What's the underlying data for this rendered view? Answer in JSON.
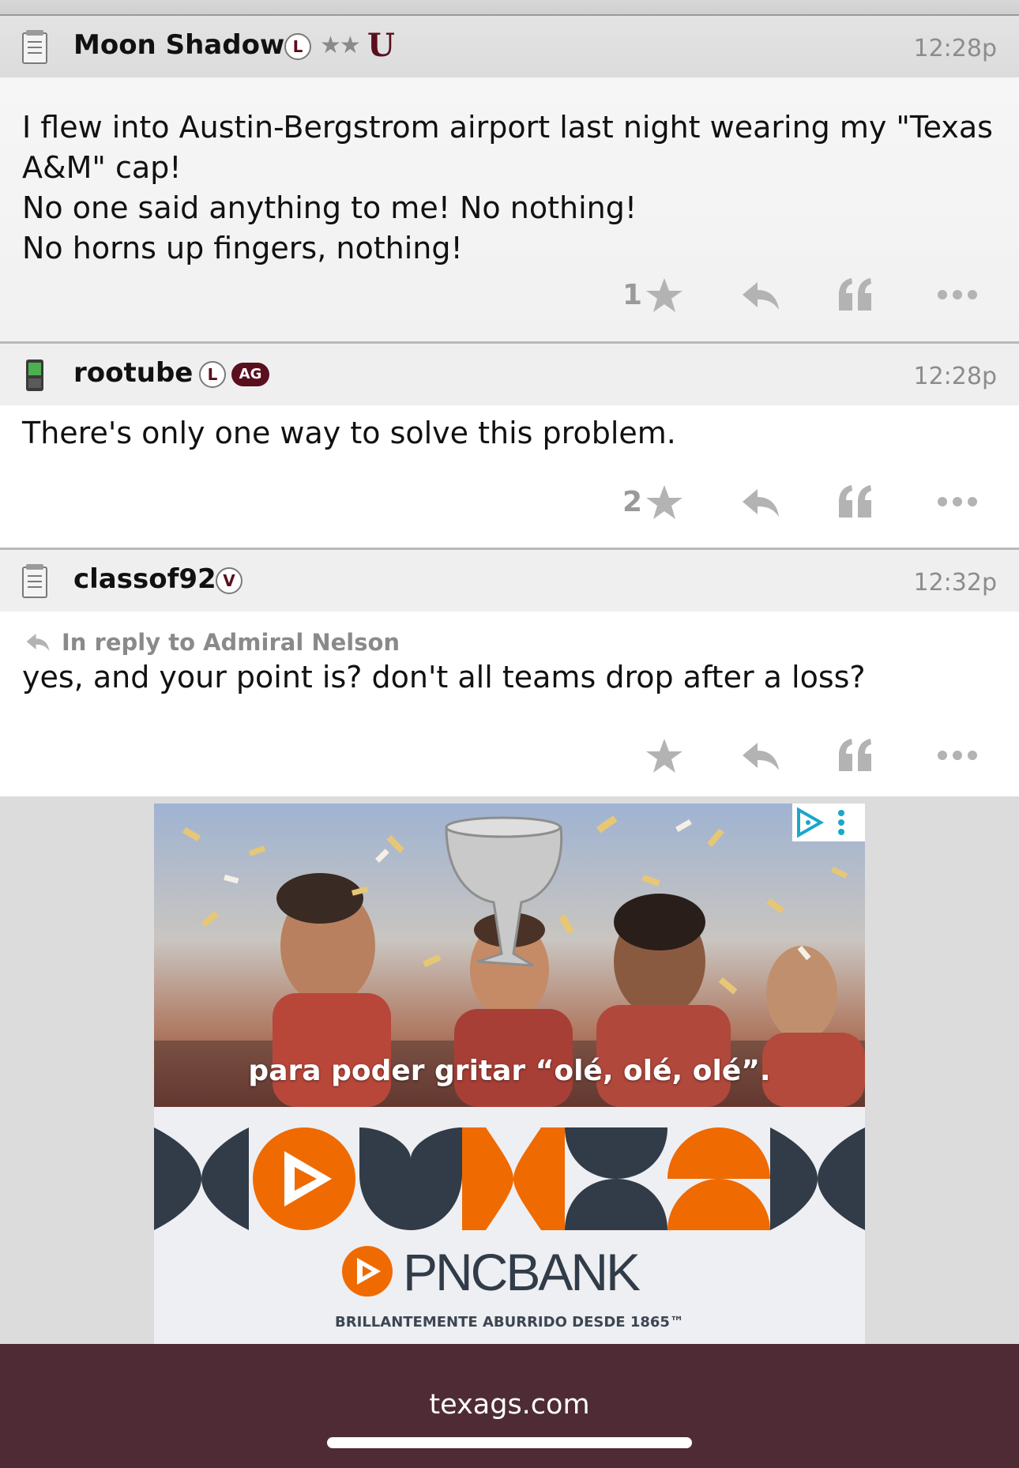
{
  "posts": [
    {
      "username": "Moon Shadow",
      "badge_letter": "L",
      "badge_stars": "★★",
      "badge_mark": "U",
      "time": "12:28p",
      "lines": [
        "I flew into Austin-Bergstrom airport last night wearing my \"Texas",
        "A&M\" cap!",
        "No one said anything to me! No nothing!",
        "No horns up fingers, nothing!"
      ],
      "star_count": "1",
      "icon": "notepad-icon"
    },
    {
      "username": "rootube",
      "badge_letter": "L",
      "badge_tag": "AG",
      "time": "12:28p",
      "lines": [
        "There's only one way to solve this problem."
      ],
      "star_count": "2",
      "icon": "phone-icon"
    },
    {
      "username": "classof92",
      "badge_letter": "V",
      "time": "12:32p",
      "reply_to": "In reply to Admiral Nelson",
      "lines": [
        "yes, and your point is? don't all teams drop after a loss?"
      ],
      "star_count": "",
      "icon": "notepad-icon"
    }
  ],
  "ad": {
    "caption": "para poder gritar “olé, olé, olé”.",
    "brand": "PNCBANK",
    "tagline": "BRILLANTEMENTE ABURRIDO DESDE 1865™",
    "brand_orange": "#ef6a00",
    "brand_slate": "#313c48"
  },
  "browser": {
    "url": "texags.com"
  },
  "colors": {
    "maroon": "#5a0f1e",
    "bottom_bar": "#4e2b35",
    "icon_gray": "#b0b0b0"
  }
}
